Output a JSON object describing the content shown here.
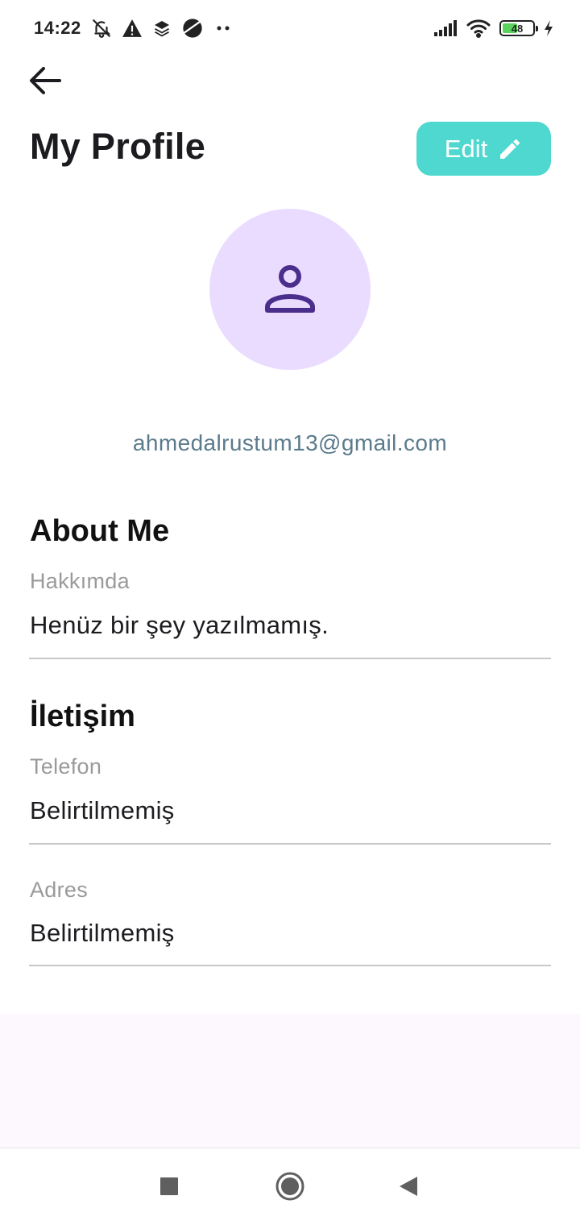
{
  "status_bar": {
    "time": "14:22",
    "battery_level": "48",
    "icons_left": [
      "bell-off-icon",
      "warning-icon",
      "layers-icon",
      "planet-icon",
      "more-dots-icon"
    ],
    "icons_right": [
      "signal-icon",
      "wifi-icon",
      "battery-icon",
      "charging-icon"
    ]
  },
  "header": {
    "back_icon": "arrow-back-icon",
    "title": "My Profile",
    "edit_label": "Edit",
    "edit_icon": "pencil-icon"
  },
  "profile": {
    "avatar_icon": "person-icon",
    "email": "ahmedalrustum13@gmail.com"
  },
  "about": {
    "title": "About Me",
    "label": "Hakkımda",
    "value": "Henüz bir şey yazılmamış."
  },
  "contact": {
    "title": "İletişim",
    "phone_label": "Telefon",
    "phone_value": "Belirtilmemiş",
    "address_label": "Adres",
    "address_value": "Belirtilmemiş"
  },
  "colors": {
    "accent": "#4fd8cf",
    "avatar_bg": "#eadcff",
    "avatar_icon": "#4b2e8c",
    "email": "#5b7b8c"
  },
  "nav_bar": {
    "recents_icon": "square-icon",
    "home_icon": "circle-icon",
    "back_icon": "triangle-back-icon"
  }
}
